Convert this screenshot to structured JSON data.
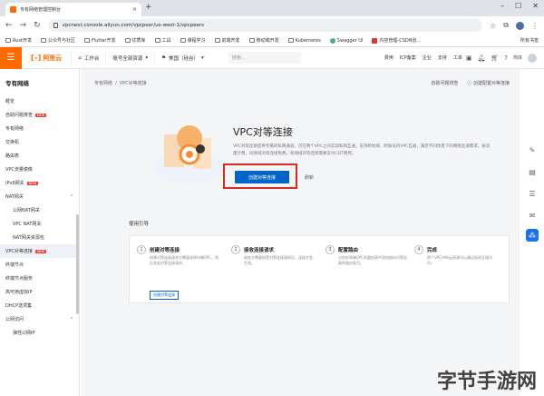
{
  "browser": {
    "tab_title": "专有网络管理控制台",
    "url": "vpcnext.console.aliyun.com/vpcpeer/us-west-1/vpcpeers",
    "bookmarks": [
      "Rust开发",
      "公众号与社区",
      "Flutter开发",
      "优质库",
      "工具",
      "课程学习",
      "前端开发",
      "移动端开发",
      "Kubernetes",
      "Swagger UI",
      "内容管理-CSDN创..."
    ],
    "all_bookmarks": "所有书签"
  },
  "console": {
    "logo": "阿里云",
    "workspace": "工作台",
    "resource_group": "账号全部资源",
    "region": "美国（硅谷）",
    "search_placeholder": "搜索...",
    "links": [
      "费用",
      "ICP备案",
      "企业",
      "支持",
      "工单"
    ],
    "lang": "简体"
  },
  "sidebar": {
    "title": "专有网络",
    "items": [
      {
        "label": "概览",
        "type": "item"
      },
      {
        "label": "自助问题排查",
        "type": "item",
        "badge": "NEW"
      },
      {
        "label": "专有网络",
        "type": "item"
      },
      {
        "label": "交换机",
        "type": "item"
      },
      {
        "label": "路由表",
        "type": "item"
      },
      {
        "label": "VPC流量镜像",
        "type": "item"
      },
      {
        "label": "IPv6网关",
        "type": "item",
        "badge": "NEW"
      },
      {
        "label": "NAT网关",
        "type": "group"
      },
      {
        "label": "公网NAT网关",
        "type": "sub"
      },
      {
        "label": "VPC NAT网关",
        "type": "sub"
      },
      {
        "label": "NAT网关资源包",
        "type": "sub"
      },
      {
        "label": "VPC对等连接",
        "type": "active",
        "badge": "NEW"
      },
      {
        "label": "终端节点",
        "type": "item"
      },
      {
        "label": "终端节点服务",
        "type": "item"
      },
      {
        "label": "高可用虚拟IP",
        "type": "item"
      },
      {
        "label": "DHCP选项集",
        "type": "item"
      },
      {
        "label": "公网访问",
        "type": "group"
      },
      {
        "label": "弹性公网IP",
        "type": "sub"
      }
    ]
  },
  "main": {
    "breadcrumb": [
      "专有网络",
      "VPC对等连接"
    ],
    "top_links": [
      "自助问题排查",
      "创建配置对等连接"
    ],
    "hero_title": "VPC对等连接",
    "hero_desc": "VPC对等连接提供专属的私网通道，可在两个VPC之间实现私网互通，支持跨地域、跨账号的VPC互通，满足不同场景下的网络连通需求。按流量计费，同地域对等连接免费，跨地域对等连接需要支付CDT费用。",
    "primary_button": "创建对等连接",
    "secondary_button": "刷新",
    "guide_title": "使用引导",
    "steps": [
      {
        "num": "1",
        "title": "创建对等连接",
        "desc": "创建对等连接请求方需要选择对端VPC，然后发起对等连接请求。",
        "link": "创建对等连接"
      },
      {
        "num": "2",
        "title": "接收连接请求",
        "desc": "接收方需要接受对等连接请求后，连接才会生效。"
      },
      {
        "num": "3",
        "title": "配置路由",
        "desc": "分别在两端VPC的路由表中添加指向对等连接的路由条目。"
      },
      {
        "num": "4",
        "title": "完成",
        "desc": "两个VPC中的云资源可以通过私网互相访问。"
      }
    ]
  },
  "watermark": "字节手游网"
}
